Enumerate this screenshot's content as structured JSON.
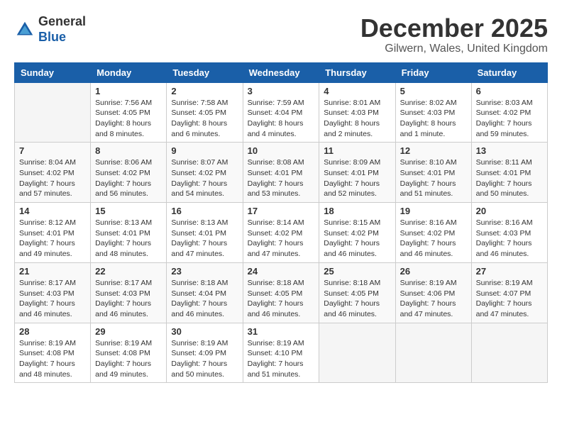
{
  "header": {
    "logo_line1": "General",
    "logo_line2": "Blue",
    "month_title": "December 2025",
    "location": "Gilwern, Wales, United Kingdom"
  },
  "weekdays": [
    "Sunday",
    "Monday",
    "Tuesday",
    "Wednesday",
    "Thursday",
    "Friday",
    "Saturday"
  ],
  "weeks": [
    [
      {
        "day": "",
        "info": ""
      },
      {
        "day": "1",
        "info": "Sunrise: 7:56 AM\nSunset: 4:05 PM\nDaylight: 8 hours\nand 8 minutes."
      },
      {
        "day": "2",
        "info": "Sunrise: 7:58 AM\nSunset: 4:05 PM\nDaylight: 8 hours\nand 6 minutes."
      },
      {
        "day": "3",
        "info": "Sunrise: 7:59 AM\nSunset: 4:04 PM\nDaylight: 8 hours\nand 4 minutes."
      },
      {
        "day": "4",
        "info": "Sunrise: 8:01 AM\nSunset: 4:03 PM\nDaylight: 8 hours\nand 2 minutes."
      },
      {
        "day": "5",
        "info": "Sunrise: 8:02 AM\nSunset: 4:03 PM\nDaylight: 8 hours\nand 1 minute."
      },
      {
        "day": "6",
        "info": "Sunrise: 8:03 AM\nSunset: 4:02 PM\nDaylight: 7 hours\nand 59 minutes."
      }
    ],
    [
      {
        "day": "7",
        "info": "Sunrise: 8:04 AM\nSunset: 4:02 PM\nDaylight: 7 hours\nand 57 minutes."
      },
      {
        "day": "8",
        "info": "Sunrise: 8:06 AM\nSunset: 4:02 PM\nDaylight: 7 hours\nand 56 minutes."
      },
      {
        "day": "9",
        "info": "Sunrise: 8:07 AM\nSunset: 4:02 PM\nDaylight: 7 hours\nand 54 minutes."
      },
      {
        "day": "10",
        "info": "Sunrise: 8:08 AM\nSunset: 4:01 PM\nDaylight: 7 hours\nand 53 minutes."
      },
      {
        "day": "11",
        "info": "Sunrise: 8:09 AM\nSunset: 4:01 PM\nDaylight: 7 hours\nand 52 minutes."
      },
      {
        "day": "12",
        "info": "Sunrise: 8:10 AM\nSunset: 4:01 PM\nDaylight: 7 hours\nand 51 minutes."
      },
      {
        "day": "13",
        "info": "Sunrise: 8:11 AM\nSunset: 4:01 PM\nDaylight: 7 hours\nand 50 minutes."
      }
    ],
    [
      {
        "day": "14",
        "info": "Sunrise: 8:12 AM\nSunset: 4:01 PM\nDaylight: 7 hours\nand 49 minutes."
      },
      {
        "day": "15",
        "info": "Sunrise: 8:13 AM\nSunset: 4:01 PM\nDaylight: 7 hours\nand 48 minutes."
      },
      {
        "day": "16",
        "info": "Sunrise: 8:13 AM\nSunset: 4:01 PM\nDaylight: 7 hours\nand 47 minutes."
      },
      {
        "day": "17",
        "info": "Sunrise: 8:14 AM\nSunset: 4:02 PM\nDaylight: 7 hours\nand 47 minutes."
      },
      {
        "day": "18",
        "info": "Sunrise: 8:15 AM\nSunset: 4:02 PM\nDaylight: 7 hours\nand 46 minutes."
      },
      {
        "day": "19",
        "info": "Sunrise: 8:16 AM\nSunset: 4:02 PM\nDaylight: 7 hours\nand 46 minutes."
      },
      {
        "day": "20",
        "info": "Sunrise: 8:16 AM\nSunset: 4:03 PM\nDaylight: 7 hours\nand 46 minutes."
      }
    ],
    [
      {
        "day": "21",
        "info": "Sunrise: 8:17 AM\nSunset: 4:03 PM\nDaylight: 7 hours\nand 46 minutes."
      },
      {
        "day": "22",
        "info": "Sunrise: 8:17 AM\nSunset: 4:03 PM\nDaylight: 7 hours\nand 46 minutes."
      },
      {
        "day": "23",
        "info": "Sunrise: 8:18 AM\nSunset: 4:04 PM\nDaylight: 7 hours\nand 46 minutes."
      },
      {
        "day": "24",
        "info": "Sunrise: 8:18 AM\nSunset: 4:05 PM\nDaylight: 7 hours\nand 46 minutes."
      },
      {
        "day": "25",
        "info": "Sunrise: 8:18 AM\nSunset: 4:05 PM\nDaylight: 7 hours\nand 46 minutes."
      },
      {
        "day": "26",
        "info": "Sunrise: 8:19 AM\nSunset: 4:06 PM\nDaylight: 7 hours\nand 47 minutes."
      },
      {
        "day": "27",
        "info": "Sunrise: 8:19 AM\nSunset: 4:07 PM\nDaylight: 7 hours\nand 47 minutes."
      }
    ],
    [
      {
        "day": "28",
        "info": "Sunrise: 8:19 AM\nSunset: 4:08 PM\nDaylight: 7 hours\nand 48 minutes."
      },
      {
        "day": "29",
        "info": "Sunrise: 8:19 AM\nSunset: 4:08 PM\nDaylight: 7 hours\nand 49 minutes."
      },
      {
        "day": "30",
        "info": "Sunrise: 8:19 AM\nSunset: 4:09 PM\nDaylight: 7 hours\nand 50 minutes."
      },
      {
        "day": "31",
        "info": "Sunrise: 8:19 AM\nSunset: 4:10 PM\nDaylight: 7 hours\nand 51 minutes."
      },
      {
        "day": "",
        "info": ""
      },
      {
        "day": "",
        "info": ""
      },
      {
        "day": "",
        "info": ""
      }
    ]
  ]
}
